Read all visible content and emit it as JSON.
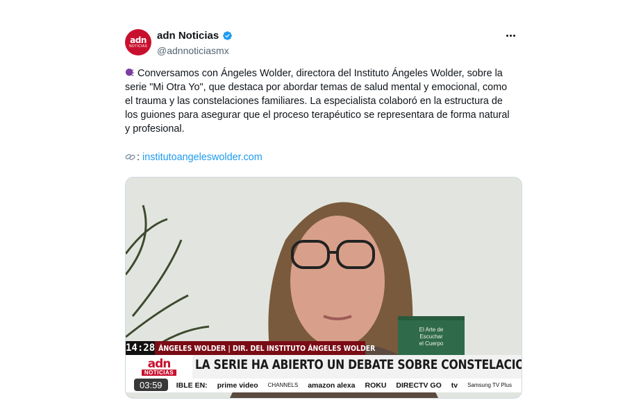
{
  "tweet": {
    "avatar": {
      "logo": "adn",
      "sub": "NOTICIAS",
      "color": "#c8102e"
    },
    "author_name": "adn Noticias",
    "handle": "@adnnoticiasmx",
    "verified_icon": "verified-badge-icon",
    "more_icon": "more-options-icon",
    "text": "Conversamos con Ángeles Wolder, directora del Instituto Ángeles Wolder, sobre la serie \"Mi Otra Yo\", que destaca por abordar temas de salud mental y emocional, como el trauma y las constelaciones familiares. La especialista colaboró en la estructura de los guiones para asegurar que el proceso terapéutico se representara de forma natural y profesional.",
    "link_prefix": ":",
    "link_text": "institutoangeleswolder.com",
    "link_color": "#1d9bf0"
  },
  "video": {
    "time": "14:28",
    "lower_third_name": "ÁNGELES WOLDER | DIR. DEL INSTITUTO ÁNGELES WOLDER",
    "logo_text": "adn",
    "logo_sub": "NOTICIAS",
    "headline": "LA SERIE HA ABIERTO UN DEBATE SOBRE CONSTELACIONES FAMILIARES",
    "duration": "03:59",
    "book_title": "El Arte de Escuchar el Cuerpo",
    "ticker": [
      "IBLE EN:",
      "prime video",
      "CHANNELS",
      "amazon alexa",
      "ROKU",
      "DIRECTV GO",
      "tv",
      "Samsung TV Plus"
    ],
    "accent": "#7a0b14"
  }
}
